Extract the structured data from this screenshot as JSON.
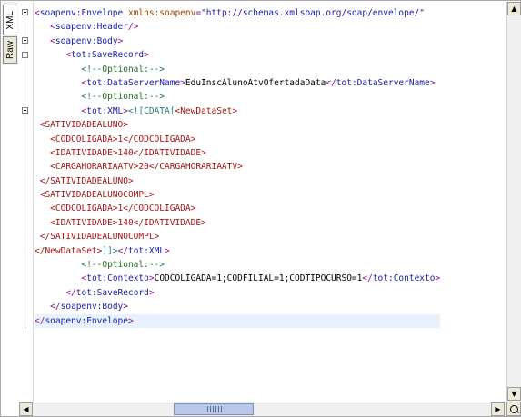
{
  "tabs": {
    "xml": "XML",
    "raw": "Raw"
  },
  "colors": {
    "tag": "#881280",
    "namespace": "#1a1aa6",
    "comment": "#236e25",
    "cdata": "#1f7f7f",
    "current_line": "#e8f2fe"
  },
  "icons": {
    "fold": "minus-box-icon",
    "zoom": "magnifier-icon"
  },
  "lines": [
    {
      "indent": "",
      "parts": [
        [
          "tag",
          "<"
        ],
        [
          "nm",
          "soapenv:Envelope"
        ],
        [
          "attr",
          " xmlns:soapenv"
        ],
        [
          "tag",
          "="
        ],
        [
          "val",
          "\"http://schemas.xmlsoap.org/soap/envelope/\""
        ]
      ]
    },
    {
      "indent": "   ",
      "parts": [
        [
          "tag",
          "<"
        ],
        [
          "nm",
          "soapenv:Header"
        ],
        [
          "tag",
          "/>"
        ]
      ]
    },
    {
      "indent": "   ",
      "parts": [
        [
          "tag",
          "<"
        ],
        [
          "nm",
          "soapenv:Body"
        ],
        [
          "tag",
          ">"
        ]
      ]
    },
    {
      "indent": "      ",
      "parts": [
        [
          "tag",
          "<"
        ],
        [
          "nm",
          "tot:SaveRecord"
        ],
        [
          "tag",
          ">"
        ]
      ]
    },
    {
      "indent": "         ",
      "parts": [
        [
          "cm",
          "<!--Optional:-->"
        ]
      ]
    },
    {
      "indent": "         ",
      "parts": [
        [
          "tag",
          "<"
        ],
        [
          "nm",
          "tot:DataServerName"
        ],
        [
          "tag",
          ">"
        ],
        [
          "tx",
          "EduInscAlunoAtvOfertadaData"
        ],
        [
          "tag",
          "</"
        ],
        [
          "nm",
          "tot:DataServerName"
        ],
        [
          "tag",
          ">"
        ]
      ]
    },
    {
      "indent": "         ",
      "parts": [
        [
          "cm",
          "<!--Optional:-->"
        ]
      ]
    },
    {
      "indent": "         ",
      "parts": [
        [
          "tag",
          "<"
        ],
        [
          "nm",
          "tot:XML"
        ],
        [
          "tag",
          ">"
        ],
        [
          "cd",
          "<![CDATA["
        ],
        [
          "t-red",
          "<NewDataSet>"
        ]
      ]
    },
    {
      "indent": " ",
      "parts": [
        [
          "t-red",
          "<SATIVIDADEALUNO>"
        ]
      ]
    },
    {
      "indent": "   ",
      "parts": [
        [
          "t-red",
          "<CODCOLIGADA>1</CODCOLIGADA>"
        ]
      ]
    },
    {
      "indent": "   ",
      "parts": [
        [
          "t-red",
          "<IDATIVIDADE>140</IDATIVIDADE>"
        ]
      ]
    },
    {
      "indent": "   ",
      "parts": [
        [
          "t-red",
          "<CARGAHORARIAATV>20</CARGAHORARIAATV>"
        ]
      ]
    },
    {
      "indent": " ",
      "parts": [
        [
          "t-red",
          "</SATIVIDADEALUNO>"
        ]
      ]
    },
    {
      "indent": " ",
      "parts": [
        [
          "t-red",
          "<SATIVIDADEALUNOCOMPL>"
        ]
      ]
    },
    {
      "indent": "   ",
      "parts": [
        [
          "t-red",
          "<CODCOLIGADA>1</CODCOLIGADA>"
        ]
      ]
    },
    {
      "indent": "   ",
      "parts": [
        [
          "t-red",
          "<IDATIVIDADE>140</IDATIVIDADE>"
        ]
      ]
    },
    {
      "indent": " ",
      "parts": [
        [
          "t-red",
          "</SATIVIDADEALUNOCOMPL>"
        ]
      ]
    },
    {
      "indent": "",
      "parts": [
        [
          "t-red",
          "</NewDataSet>"
        ],
        [
          "cd",
          "]]>"
        ],
        [
          "tag",
          "</"
        ],
        [
          "nm",
          "tot:XML"
        ],
        [
          "tag",
          ">"
        ]
      ]
    },
    {
      "indent": "         ",
      "parts": [
        [
          "cm",
          "<!--Optional:-->"
        ]
      ]
    },
    {
      "indent": "         ",
      "parts": [
        [
          "tag",
          "<"
        ],
        [
          "nm",
          "tot:Contexto"
        ],
        [
          "tag",
          ">"
        ],
        [
          "tx",
          "CODCOLIGADA=1;CODFILIAL=1;CODTIPOCURSO=1"
        ],
        [
          "tag",
          "</"
        ],
        [
          "nm",
          "tot:Contexto"
        ],
        [
          "tag",
          ">"
        ]
      ]
    },
    {
      "indent": "      ",
      "parts": [
        [
          "tag",
          "</"
        ],
        [
          "nm",
          "tot:SaveRecord"
        ],
        [
          "tag",
          ">"
        ]
      ]
    },
    {
      "indent": "   ",
      "parts": [
        [
          "tag",
          "</"
        ],
        [
          "nm",
          "soapenv:Body"
        ],
        [
          "tag",
          ">"
        ]
      ]
    },
    {
      "indent": "",
      "parts": [
        [
          "tag",
          "</"
        ],
        [
          "nm",
          "soapenv:Envelope"
        ],
        [
          "tag",
          ">"
        ]
      ],
      "current": true
    }
  ]
}
